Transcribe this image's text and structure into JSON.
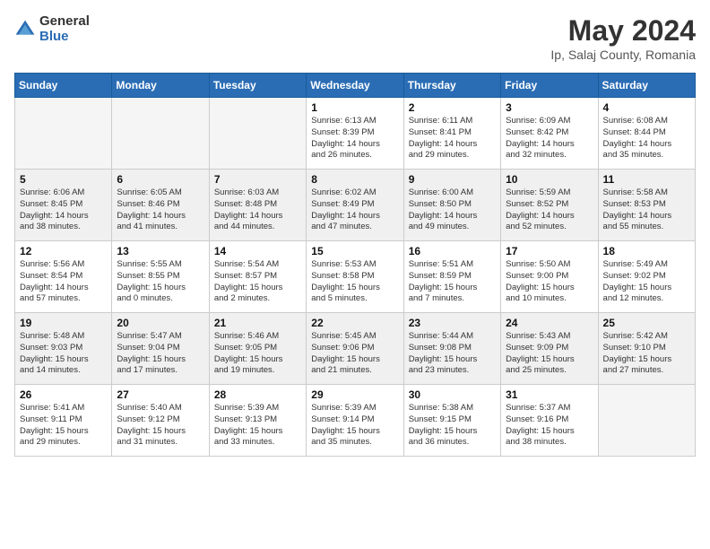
{
  "logo": {
    "general": "General",
    "blue": "Blue"
  },
  "title": "May 2024",
  "subtitle": "Ip, Salaj County, Romania",
  "days_of_week": [
    "Sunday",
    "Monday",
    "Tuesday",
    "Wednesday",
    "Thursday",
    "Friday",
    "Saturday"
  ],
  "weeks": [
    [
      {
        "num": "",
        "info": "",
        "empty": true
      },
      {
        "num": "",
        "info": "",
        "empty": true
      },
      {
        "num": "",
        "info": "",
        "empty": true
      },
      {
        "num": "1",
        "info": "Sunrise: 6:13 AM\nSunset: 8:39 PM\nDaylight: 14 hours\nand 26 minutes.",
        "empty": false
      },
      {
        "num": "2",
        "info": "Sunrise: 6:11 AM\nSunset: 8:41 PM\nDaylight: 14 hours\nand 29 minutes.",
        "empty": false
      },
      {
        "num": "3",
        "info": "Sunrise: 6:09 AM\nSunset: 8:42 PM\nDaylight: 14 hours\nand 32 minutes.",
        "empty": false
      },
      {
        "num": "4",
        "info": "Sunrise: 6:08 AM\nSunset: 8:44 PM\nDaylight: 14 hours\nand 35 minutes.",
        "empty": false
      }
    ],
    [
      {
        "num": "5",
        "info": "Sunrise: 6:06 AM\nSunset: 8:45 PM\nDaylight: 14 hours\nand 38 minutes.",
        "empty": false
      },
      {
        "num": "6",
        "info": "Sunrise: 6:05 AM\nSunset: 8:46 PM\nDaylight: 14 hours\nand 41 minutes.",
        "empty": false
      },
      {
        "num": "7",
        "info": "Sunrise: 6:03 AM\nSunset: 8:48 PM\nDaylight: 14 hours\nand 44 minutes.",
        "empty": false
      },
      {
        "num": "8",
        "info": "Sunrise: 6:02 AM\nSunset: 8:49 PM\nDaylight: 14 hours\nand 47 minutes.",
        "empty": false
      },
      {
        "num": "9",
        "info": "Sunrise: 6:00 AM\nSunset: 8:50 PM\nDaylight: 14 hours\nand 49 minutes.",
        "empty": false
      },
      {
        "num": "10",
        "info": "Sunrise: 5:59 AM\nSunset: 8:52 PM\nDaylight: 14 hours\nand 52 minutes.",
        "empty": false
      },
      {
        "num": "11",
        "info": "Sunrise: 5:58 AM\nSunset: 8:53 PM\nDaylight: 14 hours\nand 55 minutes.",
        "empty": false
      }
    ],
    [
      {
        "num": "12",
        "info": "Sunrise: 5:56 AM\nSunset: 8:54 PM\nDaylight: 14 hours\nand 57 minutes.",
        "empty": false
      },
      {
        "num": "13",
        "info": "Sunrise: 5:55 AM\nSunset: 8:55 PM\nDaylight: 15 hours\nand 0 minutes.",
        "empty": false
      },
      {
        "num": "14",
        "info": "Sunrise: 5:54 AM\nSunset: 8:57 PM\nDaylight: 15 hours\nand 2 minutes.",
        "empty": false
      },
      {
        "num": "15",
        "info": "Sunrise: 5:53 AM\nSunset: 8:58 PM\nDaylight: 15 hours\nand 5 minutes.",
        "empty": false
      },
      {
        "num": "16",
        "info": "Sunrise: 5:51 AM\nSunset: 8:59 PM\nDaylight: 15 hours\nand 7 minutes.",
        "empty": false
      },
      {
        "num": "17",
        "info": "Sunrise: 5:50 AM\nSunset: 9:00 PM\nDaylight: 15 hours\nand 10 minutes.",
        "empty": false
      },
      {
        "num": "18",
        "info": "Sunrise: 5:49 AM\nSunset: 9:02 PM\nDaylight: 15 hours\nand 12 minutes.",
        "empty": false
      }
    ],
    [
      {
        "num": "19",
        "info": "Sunrise: 5:48 AM\nSunset: 9:03 PM\nDaylight: 15 hours\nand 14 minutes.",
        "empty": false
      },
      {
        "num": "20",
        "info": "Sunrise: 5:47 AM\nSunset: 9:04 PM\nDaylight: 15 hours\nand 17 minutes.",
        "empty": false
      },
      {
        "num": "21",
        "info": "Sunrise: 5:46 AM\nSunset: 9:05 PM\nDaylight: 15 hours\nand 19 minutes.",
        "empty": false
      },
      {
        "num": "22",
        "info": "Sunrise: 5:45 AM\nSunset: 9:06 PM\nDaylight: 15 hours\nand 21 minutes.",
        "empty": false
      },
      {
        "num": "23",
        "info": "Sunrise: 5:44 AM\nSunset: 9:08 PM\nDaylight: 15 hours\nand 23 minutes.",
        "empty": false
      },
      {
        "num": "24",
        "info": "Sunrise: 5:43 AM\nSunset: 9:09 PM\nDaylight: 15 hours\nand 25 minutes.",
        "empty": false
      },
      {
        "num": "25",
        "info": "Sunrise: 5:42 AM\nSunset: 9:10 PM\nDaylight: 15 hours\nand 27 minutes.",
        "empty": false
      }
    ],
    [
      {
        "num": "26",
        "info": "Sunrise: 5:41 AM\nSunset: 9:11 PM\nDaylight: 15 hours\nand 29 minutes.",
        "empty": false
      },
      {
        "num": "27",
        "info": "Sunrise: 5:40 AM\nSunset: 9:12 PM\nDaylight: 15 hours\nand 31 minutes.",
        "empty": false
      },
      {
        "num": "28",
        "info": "Sunrise: 5:39 AM\nSunset: 9:13 PM\nDaylight: 15 hours\nand 33 minutes.",
        "empty": false
      },
      {
        "num": "29",
        "info": "Sunrise: 5:39 AM\nSunset: 9:14 PM\nDaylight: 15 hours\nand 35 minutes.",
        "empty": false
      },
      {
        "num": "30",
        "info": "Sunrise: 5:38 AM\nSunset: 9:15 PM\nDaylight: 15 hours\nand 36 minutes.",
        "empty": false
      },
      {
        "num": "31",
        "info": "Sunrise: 5:37 AM\nSunset: 9:16 PM\nDaylight: 15 hours\nand 38 minutes.",
        "empty": false
      },
      {
        "num": "",
        "info": "",
        "empty": true
      }
    ]
  ]
}
